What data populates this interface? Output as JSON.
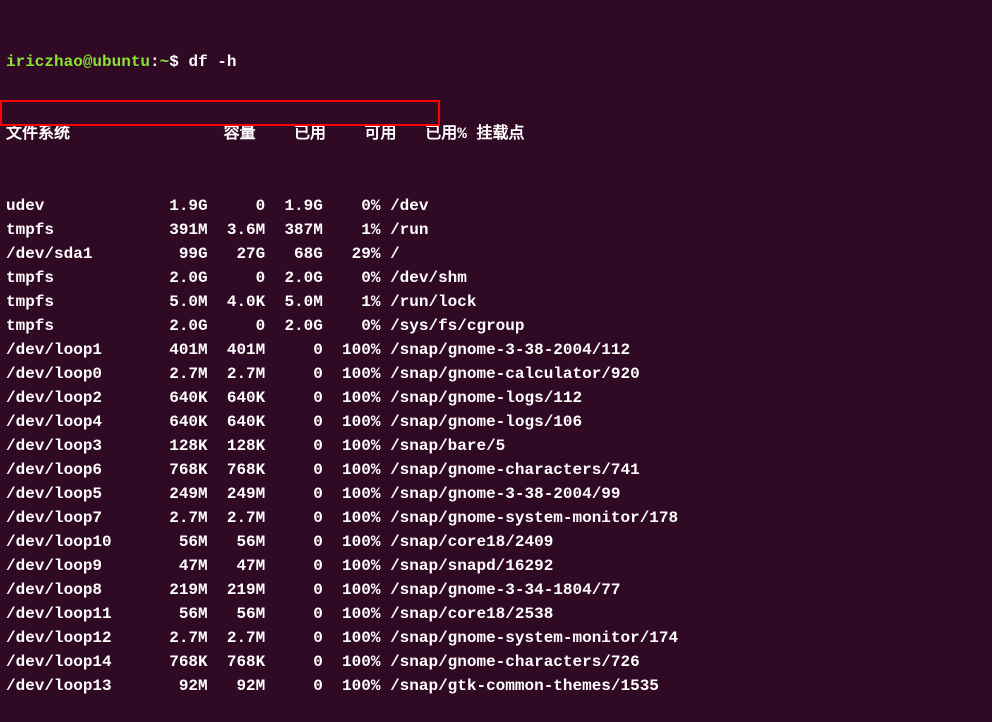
{
  "prompt": {
    "user": "iriczhao@ubuntu",
    "sep": ":",
    "path": "~",
    "dollar": "$",
    "command": "df -h"
  },
  "headers": {
    "filesystem": "文件系统",
    "size": "容量",
    "used": "已用",
    "avail": "可用",
    "use_pct": "已用%",
    "mount": "挂载点"
  },
  "rows": [
    {
      "fs": "udev",
      "size": "1.9G",
      "used": "0",
      "avail": "1.9G",
      "pct": "0%",
      "mount": "/dev"
    },
    {
      "fs": "tmpfs",
      "size": "391M",
      "used": "3.6M",
      "avail": "387M",
      "pct": "1%",
      "mount": "/run"
    },
    {
      "fs": "/dev/sda1",
      "size": "99G",
      "used": "27G",
      "avail": "68G",
      "pct": "29%",
      "mount": "/"
    },
    {
      "fs": "tmpfs",
      "size": "2.0G",
      "used": "0",
      "avail": "2.0G",
      "pct": "0%",
      "mount": "/dev/shm"
    },
    {
      "fs": "tmpfs",
      "size": "5.0M",
      "used": "4.0K",
      "avail": "5.0M",
      "pct": "1%",
      "mount": "/run/lock"
    },
    {
      "fs": "tmpfs",
      "size": "2.0G",
      "used": "0",
      "avail": "2.0G",
      "pct": "0%",
      "mount": "/sys/fs/cgroup"
    },
    {
      "fs": "/dev/loop1",
      "size": "401M",
      "used": "401M",
      "avail": "0",
      "pct": "100%",
      "mount": "/snap/gnome-3-38-2004/112"
    },
    {
      "fs": "/dev/loop0",
      "size": "2.7M",
      "used": "2.7M",
      "avail": "0",
      "pct": "100%",
      "mount": "/snap/gnome-calculator/920"
    },
    {
      "fs": "/dev/loop2",
      "size": "640K",
      "used": "640K",
      "avail": "0",
      "pct": "100%",
      "mount": "/snap/gnome-logs/112"
    },
    {
      "fs": "/dev/loop4",
      "size": "640K",
      "used": "640K",
      "avail": "0",
      "pct": "100%",
      "mount": "/snap/gnome-logs/106"
    },
    {
      "fs": "/dev/loop3",
      "size": "128K",
      "used": "128K",
      "avail": "0",
      "pct": "100%",
      "mount": "/snap/bare/5"
    },
    {
      "fs": "/dev/loop6",
      "size": "768K",
      "used": "768K",
      "avail": "0",
      "pct": "100%",
      "mount": "/snap/gnome-characters/741"
    },
    {
      "fs": "/dev/loop5",
      "size": "249M",
      "used": "249M",
      "avail": "0",
      "pct": "100%",
      "mount": "/snap/gnome-3-38-2004/99"
    },
    {
      "fs": "/dev/loop7",
      "size": "2.7M",
      "used": "2.7M",
      "avail": "0",
      "pct": "100%",
      "mount": "/snap/gnome-system-monitor/178"
    },
    {
      "fs": "/dev/loop10",
      "size": "56M",
      "used": "56M",
      "avail": "0",
      "pct": "100%",
      "mount": "/snap/core18/2409"
    },
    {
      "fs": "/dev/loop9",
      "size": "47M",
      "used": "47M",
      "avail": "0",
      "pct": "100%",
      "mount": "/snap/snapd/16292"
    },
    {
      "fs": "/dev/loop8",
      "size": "219M",
      "used": "219M",
      "avail": "0",
      "pct": "100%",
      "mount": "/snap/gnome-3-34-1804/77"
    },
    {
      "fs": "/dev/loop11",
      "size": "56M",
      "used": "56M",
      "avail": "0",
      "pct": "100%",
      "mount": "/snap/core18/2538"
    },
    {
      "fs": "/dev/loop12",
      "size": "2.7M",
      "used": "2.7M",
      "avail": "0",
      "pct": "100%",
      "mount": "/snap/gnome-system-monitor/174"
    },
    {
      "fs": "/dev/loop14",
      "size": "768K",
      "used": "768K",
      "avail": "0",
      "pct": "100%",
      "mount": "/snap/gnome-characters/726"
    },
    {
      "fs": "/dev/loop13",
      "size": "92M",
      "used": "92M",
      "avail": "0",
      "pct": "100%",
      "mount": "/snap/gtk-common-themes/1535"
    }
  ]
}
